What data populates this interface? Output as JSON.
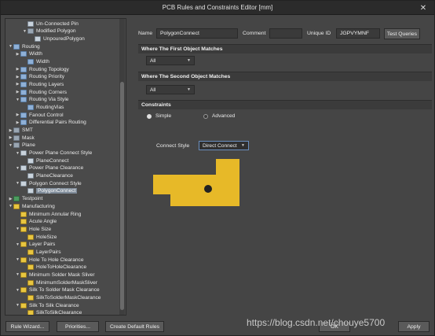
{
  "window": {
    "title": "PCB Rules and Constraints Editor [mm]",
    "close_glyph": "✕"
  },
  "tree": [
    {
      "label": "Un-Connected Pin",
      "icon": "rule-icon"
    },
    {
      "label": "Modified Polygon",
      "icon": "folder-icon"
    },
    {
      "label": "UnpouredPolygon",
      "icon": "rule-icon"
    },
    {
      "label": "Routing",
      "icon": "routing-icon"
    },
    {
      "label": "Width",
      "icon": "routing-icon"
    },
    {
      "label": "Width",
      "icon": "routing-icon"
    },
    {
      "label": "Routing Topology",
      "icon": "routing-icon"
    },
    {
      "label": "Routing Priority",
      "icon": "routing-icon"
    },
    {
      "label": "Routing Layers",
      "icon": "routing-icon"
    },
    {
      "label": "Routing Corners",
      "icon": "routing-icon"
    },
    {
      "label": "Routing Via Style",
      "icon": "routing-icon"
    },
    {
      "label": "RoutingVias",
      "icon": "routing-icon"
    },
    {
      "label": "Fanout Control",
      "icon": "routing-icon"
    },
    {
      "label": "Differential Pairs Routing",
      "icon": "routing-icon"
    },
    {
      "label": "SMT",
      "icon": "folder-icon"
    },
    {
      "label": "Mask",
      "icon": "folder-icon"
    },
    {
      "label": "Plane",
      "icon": "folder-icon"
    },
    {
      "label": "Power Plane Connect Style",
      "icon": "rule-icon"
    },
    {
      "label": "PlaneConnect",
      "icon": "rule-icon"
    },
    {
      "label": "Power Plane Clearance",
      "icon": "rule-icon"
    },
    {
      "label": "PlaneClearance",
      "icon": "rule-icon"
    },
    {
      "label": "Polygon Connect Style",
      "icon": "rule-icon"
    },
    {
      "label": "PolygonConnect",
      "icon": "rule-icon"
    },
    {
      "label": "Testpoint",
      "icon": "testpoint-icon"
    },
    {
      "label": "Manufacturing",
      "icon": "manufacturing-icon"
    },
    {
      "label": "Minimum Annular Ring",
      "icon": "manufacturing-icon"
    },
    {
      "label": "Acute Angle",
      "icon": "manufacturing-icon"
    },
    {
      "label": "Hole Size",
      "icon": "manufacturing-icon"
    },
    {
      "label": "HoleSize",
      "icon": "manufacturing-icon"
    },
    {
      "label": "Layer Pairs",
      "icon": "manufacturing-icon"
    },
    {
      "label": "LayerPairs",
      "icon": "manufacturing-icon"
    },
    {
      "label": "Hole To Hole Clearance",
      "icon": "manufacturing-icon"
    },
    {
      "label": "HoleToHoleClearance",
      "icon": "manufacturing-icon"
    },
    {
      "label": "Minimum Solder Mask Sliver",
      "icon": "manufacturing-icon"
    },
    {
      "label": "MinimumSolderMaskSliver",
      "icon": "manufacturing-icon"
    },
    {
      "label": "Silk To Solder Mask Clearance",
      "icon": "manufacturing-icon"
    },
    {
      "label": "SilkToSolderMaskClearance",
      "icon": "manufacturing-icon"
    },
    {
      "label": "Silk To Silk Clearance",
      "icon": "manufacturing-icon"
    },
    {
      "label": "SilkToSilkClearance",
      "icon": "manufacturing-icon"
    }
  ],
  "rule": {
    "name_label": "Name",
    "name_value": "PolygonConnect",
    "comment_label": "Comment",
    "comment_value": "",
    "uid_label": "Unique ID",
    "uid_value": "JGPVYMNF",
    "test_queries": "Test Queries"
  },
  "first_match": {
    "header": "Where The First Object Matches",
    "value": "All"
  },
  "second_match": {
    "header": "Where The Second Object Matches",
    "value": "All"
  },
  "constraints": {
    "header": "Constraints",
    "simple": "Simple",
    "advanced": "Advanced",
    "connect_style_label": "Connect Style",
    "connect_style_value": "Direct Connect"
  },
  "buttons": {
    "rule_wizard": "Rule Wizard...",
    "priorities": "Priorities...",
    "create_default": "Create Default Rules",
    "ok": "OK",
    "apply": "Apply"
  },
  "watermark": "https://blog.csdn.net/chouye5700",
  "colors": {
    "polygon": "#e7b928",
    "pad": "#222222"
  }
}
